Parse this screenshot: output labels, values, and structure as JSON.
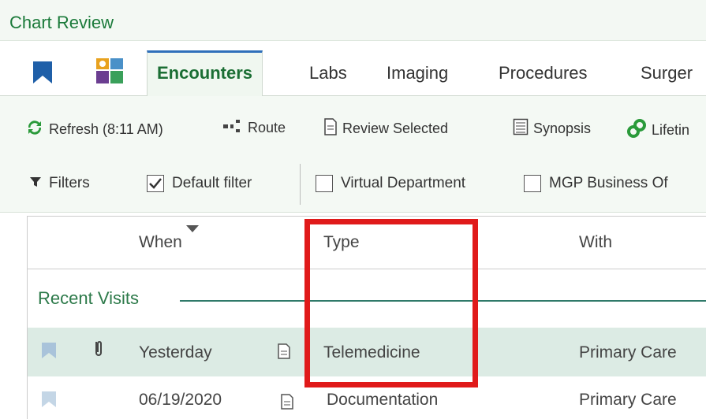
{
  "window": {
    "title": "Chart Review"
  },
  "tabs": [
    {
      "label": "Encounters",
      "active": true
    },
    {
      "label": "Labs"
    },
    {
      "label": "Imaging"
    },
    {
      "label": "Procedures"
    },
    {
      "label": "Surger"
    }
  ],
  "toolbar": {
    "refresh_label": "Refresh (8:11 AM)",
    "route_label": "Route",
    "review_selected_label": "Review Selected",
    "synopsis_label": "Synopsis",
    "lifetime_label": "Lifetin"
  },
  "filters": {
    "filters_label": "Filters",
    "default_filter_label": "Default filter",
    "default_filter_checked": true,
    "virtual_department_label": "Virtual Department",
    "virtual_department_checked": false,
    "mgp_business_label": "MGP Business Of",
    "mgp_business_checked": false
  },
  "grid": {
    "columns": [
      "When",
      "Type",
      "With"
    ],
    "section_label": "Recent Visits",
    "rows": [
      {
        "when": "Yesterday",
        "type": "Telemedicine",
        "with": "Primary Care",
        "selected": true
      },
      {
        "when": "06/19/2020",
        "type": "Documentation",
        "with": "Primary Care",
        "selected": false
      }
    ]
  },
  "colors": {
    "title_green": "#1b7a3a",
    "accent_blue": "#2f6fba",
    "highlight_red": "#e01a1a",
    "row_selected": "#dcebe4"
  }
}
